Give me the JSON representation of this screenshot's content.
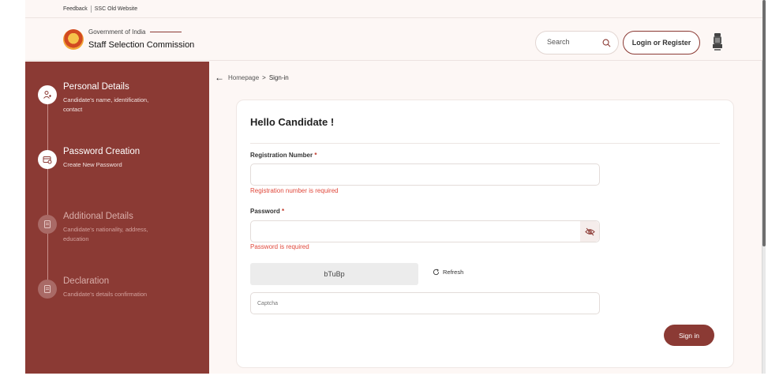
{
  "topbar": {
    "feedback": "Feedback",
    "old_site": "SSC Old Website"
  },
  "header": {
    "gov_label": "Government of India",
    "org_name": "Staff Selection Commission",
    "search_placeholder": "Search",
    "login_label": "Login or Register"
  },
  "sidebar": {
    "steps": [
      {
        "title": "Personal Details",
        "subtitle": "Candidate's name, identification, contact",
        "state": "done",
        "icon": "user-plus-icon"
      },
      {
        "title": "Password Creation",
        "subtitle": "Create New Password",
        "state": "active",
        "icon": "password-card-icon"
      },
      {
        "title": "Additional Details",
        "subtitle": "Candidate's nationality, address, education",
        "state": "pending",
        "icon": "document-icon"
      },
      {
        "title": "Declaration",
        "subtitle": "Candidate's details confirmation",
        "state": "pending",
        "icon": "document-icon"
      }
    ]
  },
  "breadcrumb": {
    "home": "Homepage",
    "separator": ">",
    "current": "Sign-in"
  },
  "form": {
    "heading": "Hello Candidate !",
    "registration_label": "Registration Number",
    "registration_error": "Registration number is required",
    "password_label": "Password",
    "password_error": "Password is required",
    "required_mark": "*",
    "captcha_text": "bTuBp",
    "refresh_label": "Refresh",
    "captcha_placeholder": "Captcha",
    "signin_label": "Sign in"
  },
  "colors": {
    "brand": "#8b3a34",
    "error": "#e0483b",
    "background": "#fdf7f5"
  }
}
